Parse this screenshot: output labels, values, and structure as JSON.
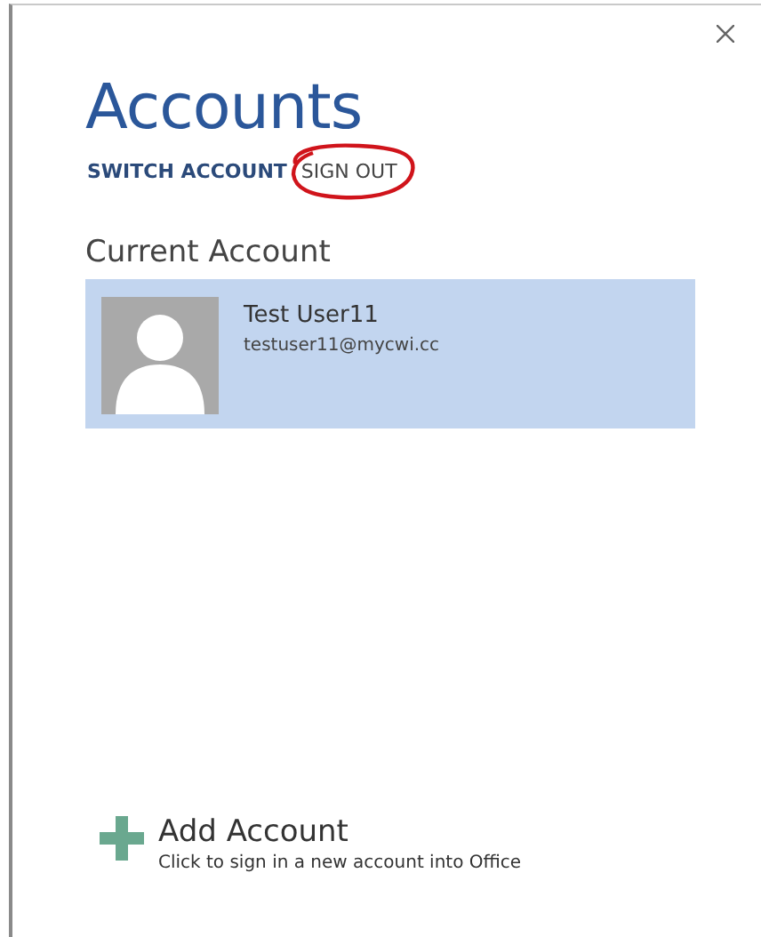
{
  "title": "Accounts",
  "nav": [
    {
      "label": "SWITCH ACCOUNT",
      "selected": true
    },
    {
      "label": "SIGN OUT",
      "selected": false,
      "circled": true
    }
  ],
  "current_account": {
    "heading": "Current Account",
    "accounts": [
      {
        "name": "Test User11",
        "email": "testuser11@mycwi.cc",
        "selected": true
      }
    ]
  },
  "add_account": {
    "label": "Add Account",
    "description": "Click to sign in a new account into Office"
  }
}
